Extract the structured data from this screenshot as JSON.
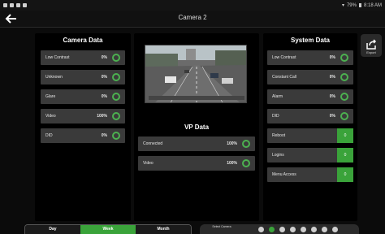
{
  "status": {
    "time": "8:18 AM",
    "battery": "79%"
  },
  "header": {
    "title": "Camera 2"
  },
  "camera_data": {
    "title": "Camera Data",
    "rows": [
      {
        "label": "Low Contrast",
        "value": "0%"
      },
      {
        "label": "Unknown",
        "value": "0%"
      },
      {
        "label": "Glare",
        "value": "0%"
      },
      {
        "label": "Video",
        "value": "100%"
      },
      {
        "label": "DID",
        "value": "0%"
      }
    ]
  },
  "vp_data": {
    "title": "VP Data",
    "rows": [
      {
        "label": "Connected",
        "value": "100%"
      },
      {
        "label": "Video",
        "value": "100%"
      }
    ]
  },
  "system_data": {
    "title": "System Data",
    "rows": [
      {
        "label": "Low Contrast",
        "value": "0%"
      },
      {
        "label": "Constant Call",
        "value": "0%"
      },
      {
        "label": "Alarm",
        "value": "0%"
      },
      {
        "label": "DID",
        "value": "0%"
      }
    ],
    "counters": [
      {
        "label": "Reboot",
        "value": "0"
      },
      {
        "label": "Logins",
        "value": "0"
      },
      {
        "label": "Menu Access",
        "value": "0"
      }
    ]
  },
  "export": {
    "label": "Export"
  },
  "range": {
    "options": [
      "Day",
      "Week",
      "Month"
    ],
    "selected": "Week"
  },
  "camera_select": {
    "label": "Select Camera",
    "count": 8,
    "selected_index": 1
  },
  "colors": {
    "accent": "#3aa33a",
    "row_bg": "#3a3a3a",
    "panel_bg": "#000000"
  }
}
